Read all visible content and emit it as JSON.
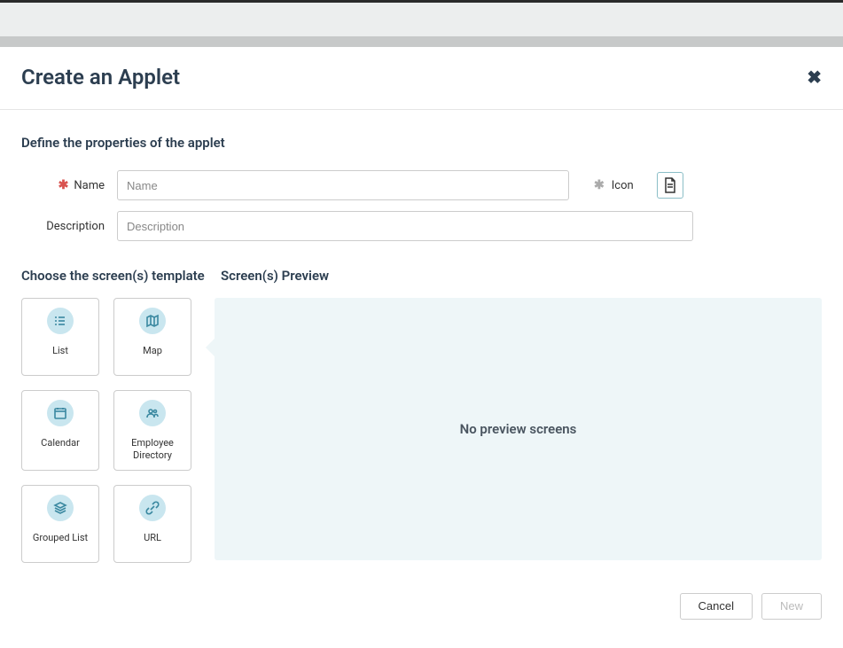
{
  "header": {
    "title": "Create an Applet"
  },
  "section_properties_label": "Define the properties of the applet",
  "form": {
    "name_label": "Name",
    "name_placeholder": "Name",
    "name_value": "",
    "description_label": "Description",
    "description_placeholder": "Description",
    "description_value": "",
    "icon_label": "Icon"
  },
  "section_template_label": "Choose the screen(s) template",
  "section_preview_label": "Screen(s) Preview",
  "templates": [
    {
      "label": "List",
      "icon": "list-icon"
    },
    {
      "label": "Map",
      "icon": "map-icon"
    },
    {
      "label": "Calendar",
      "icon": "calendar-icon"
    },
    {
      "label": "Employee Directory",
      "icon": "people-icon"
    },
    {
      "label": "Grouped List",
      "icon": "layers-icon"
    },
    {
      "label": "URL",
      "icon": "link-icon"
    }
  ],
  "preview": {
    "empty_text": "No preview screens"
  },
  "footer": {
    "cancel_label": "Cancel",
    "new_label": "New"
  }
}
